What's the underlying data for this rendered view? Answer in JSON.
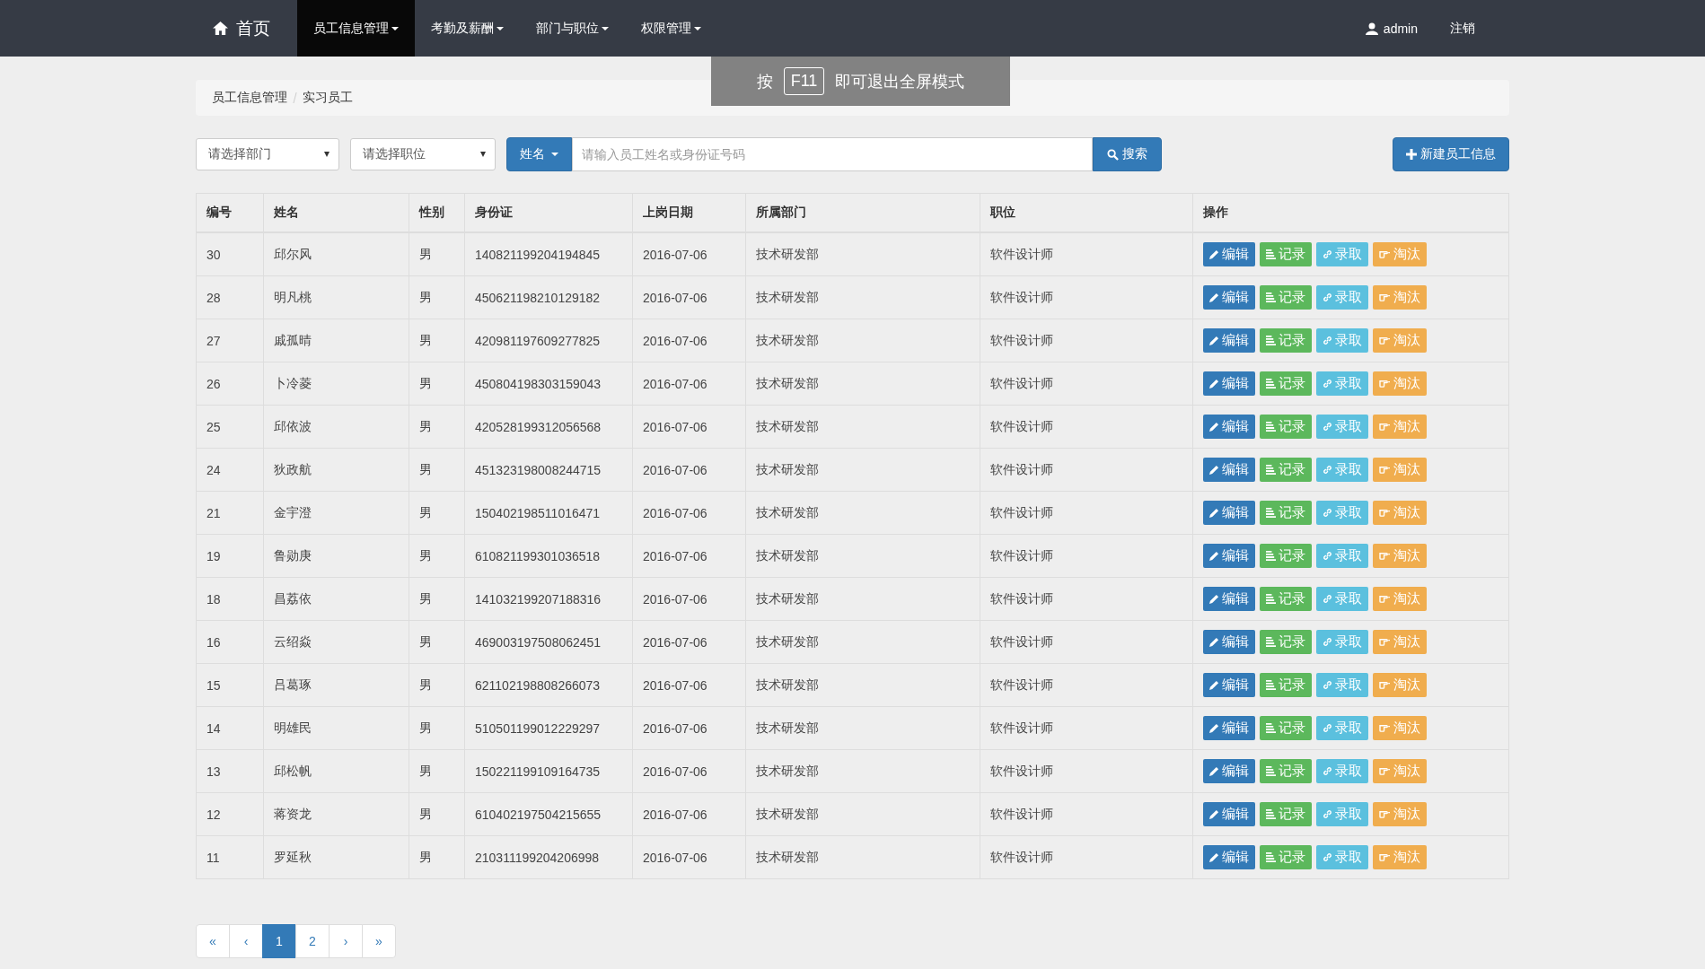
{
  "navbar": {
    "home": "首页",
    "menus": [
      {
        "label": "员工信息管理",
        "selected": true
      },
      {
        "label": "考勤及薪酬",
        "selected": false
      },
      {
        "label": "部门与职位",
        "selected": false
      },
      {
        "label": "权限管理",
        "selected": false
      }
    ],
    "user": "admin",
    "logout": "注销"
  },
  "fullscreen_notice": {
    "before": "按",
    "key": "F11",
    "after": "即可退出全屏模式"
  },
  "breadcrumb": [
    "员工信息管理",
    "实习员工"
  ],
  "filters": {
    "department": {
      "placeholder": "请选择部门"
    },
    "position": {
      "placeholder": "请选择职位"
    },
    "search_by": "姓名",
    "search": {
      "placeholder": "请输入员工姓名或身份证号码"
    },
    "search_button": "搜索",
    "new_button": "新建员工信息"
  },
  "table": {
    "columns": [
      "编号",
      "姓名",
      "性别",
      "身份证",
      "上岗日期",
      "所属部门",
      "职位",
      "操作"
    ],
    "rows": [
      {
        "cells": [
          "30",
          "邱尔风",
          "男",
          "140821199204194845",
          "2016-07-06",
          "技术研发部",
          "软件设计师"
        ],
        "actions": [
          {
            "kind": "edit",
            "label": "编辑"
          },
          {
            "kind": "record",
            "label": "记录"
          },
          {
            "kind": "hire",
            "label": "录取"
          },
          {
            "kind": "dismiss",
            "label": "淘汰"
          }
        ]
      },
      {
        "cells": [
          "28",
          "明凡桃",
          "男",
          "450621198210129182",
          "2016-07-06",
          "技术研发部",
          "软件设计师"
        ],
        "actions": [
          {
            "kind": "edit",
            "label": "编辑"
          },
          {
            "kind": "record",
            "label": "记录"
          },
          {
            "kind": "hire",
            "label": "录取"
          },
          {
            "kind": "dismiss",
            "label": "淘汰"
          }
        ]
      },
      {
        "cells": [
          "27",
          "戚孤晴",
          "男",
          "420981197609277825",
          "2016-07-06",
          "技术研发部",
          "软件设计师"
        ],
        "actions": [
          {
            "kind": "edit",
            "label": "编辑"
          },
          {
            "kind": "record",
            "label": "记录"
          },
          {
            "kind": "hire",
            "label": "录取"
          },
          {
            "kind": "dismiss",
            "label": "淘汰"
          }
        ]
      },
      {
        "cells": [
          "26",
          "卜冷菱",
          "男",
          "450804198303159043",
          "2016-07-06",
          "技术研发部",
          "软件设计师"
        ],
        "actions": [
          {
            "kind": "edit",
            "label": "编辑"
          },
          {
            "kind": "record",
            "label": "记录"
          },
          {
            "kind": "hire",
            "label": "录取"
          },
          {
            "kind": "dismiss",
            "label": "淘汰"
          }
        ]
      },
      {
        "cells": [
          "25",
          "邱依波",
          "男",
          "420528199312056568",
          "2016-07-06",
          "技术研发部",
          "软件设计师"
        ],
        "actions": [
          {
            "kind": "edit",
            "label": "编辑"
          },
          {
            "kind": "record",
            "label": "记录"
          },
          {
            "kind": "hire",
            "label": "录取"
          },
          {
            "kind": "dismiss",
            "label": "淘汰"
          }
        ]
      },
      {
        "cells": [
          "24",
          "狄政航",
          "男",
          "451323198008244715",
          "2016-07-06",
          "技术研发部",
          "软件设计师"
        ],
        "actions": [
          {
            "kind": "edit",
            "label": "编辑"
          },
          {
            "kind": "record",
            "label": "记录"
          },
          {
            "kind": "hire",
            "label": "录取"
          },
          {
            "kind": "dismiss",
            "label": "淘汰"
          }
        ]
      },
      {
        "cells": [
          "21",
          "金宇澄",
          "男",
          "150402198511016471",
          "2016-07-06",
          "技术研发部",
          "软件设计师"
        ],
        "actions": [
          {
            "kind": "edit",
            "label": "编辑"
          },
          {
            "kind": "record",
            "label": "记录"
          },
          {
            "kind": "hire",
            "label": "录取"
          },
          {
            "kind": "dismiss",
            "label": "淘汰"
          }
        ]
      },
      {
        "cells": [
          "19",
          "鲁勋庚",
          "男",
          "610821199301036518",
          "2016-07-06",
          "技术研发部",
          "软件设计师"
        ],
        "actions": [
          {
            "kind": "edit",
            "label": "编辑"
          },
          {
            "kind": "record",
            "label": "记录"
          },
          {
            "kind": "hire",
            "label": "录取"
          },
          {
            "kind": "dismiss",
            "label": "淘汰"
          }
        ]
      },
      {
        "cells": [
          "18",
          "昌荔依",
          "男",
          "141032199207188316",
          "2016-07-06",
          "技术研发部",
          "软件设计师"
        ],
        "actions": [
          {
            "kind": "edit",
            "label": "编辑"
          },
          {
            "kind": "record",
            "label": "记录"
          },
          {
            "kind": "hire",
            "label": "录取"
          },
          {
            "kind": "dismiss",
            "label": "淘汰"
          }
        ]
      },
      {
        "cells": [
          "16",
          "云绍焱",
          "男",
          "469003197508062451",
          "2016-07-06",
          "技术研发部",
          "软件设计师"
        ],
        "actions": [
          {
            "kind": "edit",
            "label": "编辑"
          },
          {
            "kind": "record",
            "label": "记录"
          },
          {
            "kind": "hire",
            "label": "录取"
          },
          {
            "kind": "dismiss",
            "label": "淘汰"
          }
        ]
      },
      {
        "cells": [
          "15",
          "吕葛琢",
          "男",
          "621102198808266073",
          "2016-07-06",
          "技术研发部",
          "软件设计师"
        ],
        "actions": [
          {
            "kind": "edit",
            "label": "编辑"
          },
          {
            "kind": "record",
            "label": "记录"
          },
          {
            "kind": "hire",
            "label": "录取"
          },
          {
            "kind": "dismiss",
            "label": "淘汰"
          }
        ]
      },
      {
        "cells": [
          "14",
          "明雄民",
          "男",
          "510501199012229297",
          "2016-07-06",
          "技术研发部",
          "软件设计师"
        ],
        "actions": [
          {
            "kind": "edit",
            "label": "编辑"
          },
          {
            "kind": "record",
            "label": "记录"
          },
          {
            "kind": "hire",
            "label": "录取"
          },
          {
            "kind": "dismiss",
            "label": "淘汰"
          }
        ]
      },
      {
        "cells": [
          "13",
          "邱松帆",
          "男",
          "150221199109164735",
          "2016-07-06",
          "技术研发部",
          "软件设计师"
        ],
        "actions": [
          {
            "kind": "edit",
            "label": "编辑"
          },
          {
            "kind": "record",
            "label": "记录"
          },
          {
            "kind": "hire",
            "label": "录取"
          },
          {
            "kind": "dismiss",
            "label": "淘汰"
          }
        ]
      },
      {
        "cells": [
          "12",
          "蒋资龙",
          "男",
          "610402197504215655",
          "2016-07-06",
          "技术研发部",
          "软件设计师"
        ],
        "actions": [
          {
            "kind": "edit",
            "label": "编辑"
          },
          {
            "kind": "record",
            "label": "记录"
          },
          {
            "kind": "hire",
            "label": "录取"
          },
          {
            "kind": "dismiss",
            "label": "淘汰"
          }
        ]
      },
      {
        "cells": [
          "11",
          "罗延秋",
          "男",
          "210311199204206998",
          "2016-07-06",
          "技术研发部",
          "软件设计师"
        ],
        "actions": [
          {
            "kind": "edit",
            "label": "编辑"
          },
          {
            "kind": "record",
            "label": "记录"
          },
          {
            "kind": "hire",
            "label": "录取"
          },
          {
            "kind": "dismiss",
            "label": "淘汰"
          }
        ]
      }
    ]
  },
  "pagination": [
    {
      "label": "«",
      "selected": false
    },
    {
      "label": "‹",
      "selected": false
    },
    {
      "label": "1",
      "selected": true
    },
    {
      "label": "2",
      "selected": false
    },
    {
      "label": "›",
      "selected": false
    },
    {
      "label": "»",
      "selected": false
    }
  ]
}
